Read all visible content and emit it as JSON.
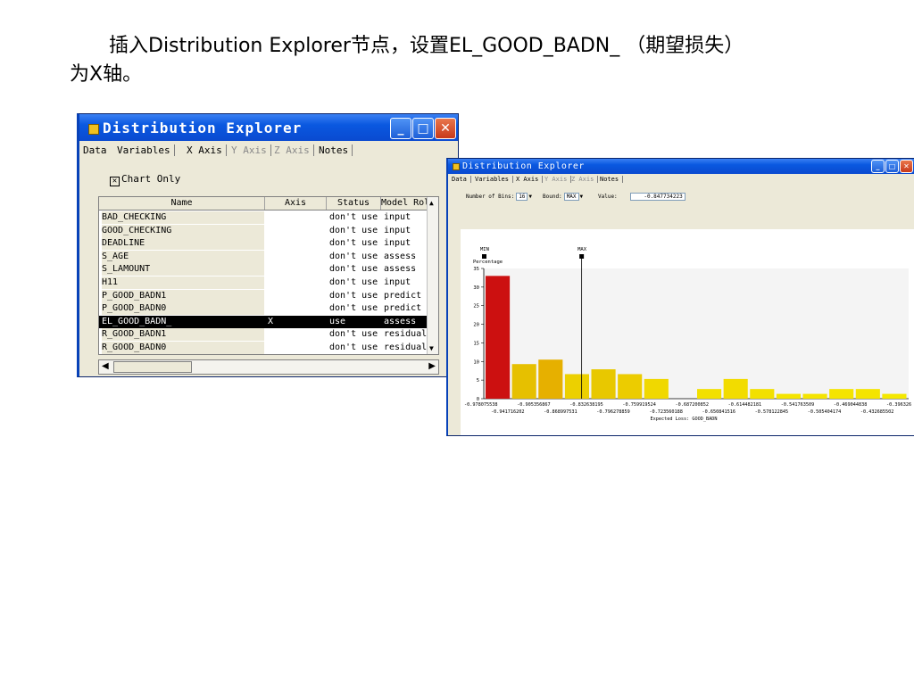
{
  "caption": {
    "line1": "插入Distribution Explorer节点，设置EL_GOOD_BADN_ （期望损失）",
    "line2": "为X轴。"
  },
  "window1": {
    "title": "Distribution Explorer",
    "buttons": {
      "minimize": "_",
      "maximize": "□",
      "close": "✕"
    },
    "tabs": [
      "Data",
      "Variables",
      "X Axis",
      "Y Axis",
      "Z Axis",
      "Notes"
    ],
    "chart_only_label": "Chart Only",
    "chart_only_checked": true,
    "table": {
      "columns": [
        "Name",
        "Axis",
        "Status",
        "Model Role"
      ],
      "rows": [
        {
          "name": "BAD_CHECKING",
          "axis": "",
          "status": "don't use",
          "role": "input"
        },
        {
          "name": "GOOD_CHECKING",
          "axis": "",
          "status": "don't use",
          "role": "input"
        },
        {
          "name": "DEADLINE",
          "axis": "",
          "status": "don't use",
          "role": "input"
        },
        {
          "name": "S_AGE",
          "axis": "",
          "status": "don't use",
          "role": "assess"
        },
        {
          "name": "S_LAMOUNT",
          "axis": "",
          "status": "don't use",
          "role": "assess"
        },
        {
          "name": "H11",
          "axis": "",
          "status": "don't use",
          "role": "input"
        },
        {
          "name": "P_GOOD_BADN1",
          "axis": "",
          "status": "don't use",
          "role": "predict"
        },
        {
          "name": "P_GOOD_BADN0",
          "axis": "",
          "status": "don't use",
          "role": "predict"
        },
        {
          "name": "EL_GOOD_BADN_",
          "axis": "X",
          "status": "use",
          "role": "assess"
        },
        {
          "name": "R_GOOD_BADN1",
          "axis": "",
          "status": "don't use",
          "role": "residual"
        },
        {
          "name": "R_GOOD_BADN0",
          "axis": "",
          "status": "don't use",
          "role": "residual"
        }
      ],
      "selected_row": 8
    }
  },
  "window2": {
    "title": "Distribution Explorer",
    "tabs": [
      "Data",
      "Variables",
      "X Axis",
      "Y Axis",
      "Z Axis",
      "Notes"
    ],
    "controls": {
      "bins_label": "Number of Bins:",
      "bins_value": "16",
      "bound_label": "Bound:",
      "bound_value": "MAX",
      "value_label": "Value:",
      "value_value": "-0.847734223"
    }
  },
  "chart_data": {
    "type": "bar",
    "ylabel": "Percentage",
    "xlabel": "Expected Loss: GOOD_BADN",
    "ylim": [
      0,
      35
    ],
    "yticks": [
      0,
      5,
      10,
      15,
      20,
      25,
      30,
      35
    ],
    "values": [
      33,
      9.3,
      10.5,
      6.6,
      7.9,
      6.6,
      5.3,
      0,
      2.6,
      5.3,
      2.6,
      1.3,
      1.3,
      2.6,
      2.6,
      1.3
    ],
    "bar_colors": [
      "#cc1010",
      "#e6c000",
      "#e6b000",
      "#ecd000",
      "#e8c800",
      "#eccc00",
      "#f0d800",
      "#f2e000",
      "#f2e000",
      "#f2dc00",
      "#f2e000",
      "#f4e400",
      "#f4e400",
      "#f4e400",
      "#f4e400",
      "#f4e800"
    ],
    "tick_labels_row1": [
      "-0.978075538",
      "-0.905356867",
      "-0.832638195",
      "-0.759919524",
      "-0.687200852",
      "-0.614482181",
      "-0.541763509",
      "-0.469044838",
      "-0.396326"
    ],
    "tick_labels_row2": [
      "-0.941716202",
      "-0.868997531",
      "-0.796278859",
      "-0.723560188",
      "-0.650841516",
      "-0.578122845",
      "-0.505404174",
      "-0.432685502"
    ],
    "markers": {
      "min_label": "MIN",
      "max_label": "MAX"
    },
    "grid": false
  }
}
